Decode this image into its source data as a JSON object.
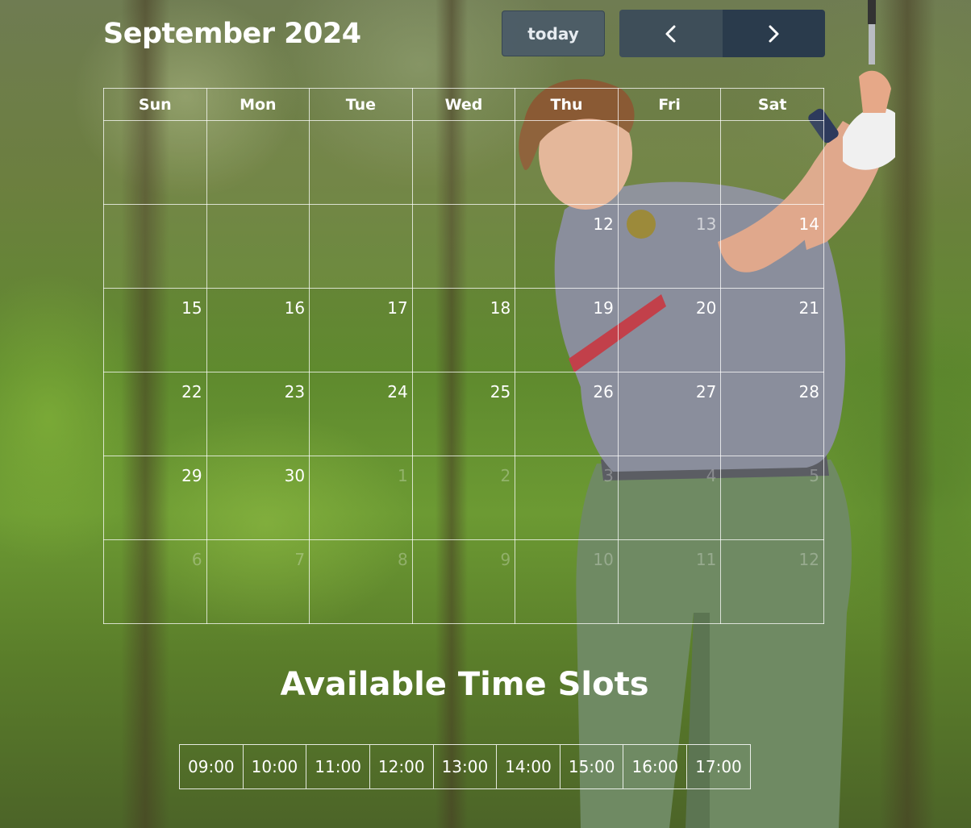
{
  "calendar": {
    "title": "September 2024",
    "today_label": "today",
    "prev_icon": "chevron-left-icon",
    "next_icon": "chevron-right-icon",
    "weekdays": [
      "Sun",
      "Mon",
      "Tue",
      "Wed",
      "Thu",
      "Fri",
      "Sat"
    ],
    "weeks": [
      [
        {
          "d": "",
          "s": "empty"
        },
        {
          "d": "",
          "s": "empty"
        },
        {
          "d": "",
          "s": "empty"
        },
        {
          "d": "",
          "s": "empty"
        },
        {
          "d": "",
          "s": "empty"
        },
        {
          "d": "",
          "s": "empty"
        },
        {
          "d": "",
          "s": "empty"
        }
      ],
      [
        {
          "d": "",
          "s": "empty"
        },
        {
          "d": "",
          "s": "empty"
        },
        {
          "d": "",
          "s": "empty"
        },
        {
          "d": "",
          "s": "empty"
        },
        {
          "d": "12",
          "s": "current"
        },
        {
          "d": "13",
          "s": "past"
        },
        {
          "d": "14",
          "s": "current"
        }
      ],
      [
        {
          "d": "15",
          "s": "current"
        },
        {
          "d": "16",
          "s": "current"
        },
        {
          "d": "17",
          "s": "current"
        },
        {
          "d": "18",
          "s": "current"
        },
        {
          "d": "19",
          "s": "current"
        },
        {
          "d": "20",
          "s": "current"
        },
        {
          "d": "21",
          "s": "current"
        }
      ],
      [
        {
          "d": "22",
          "s": "current"
        },
        {
          "d": "23",
          "s": "current"
        },
        {
          "d": "24",
          "s": "current"
        },
        {
          "d": "25",
          "s": "current"
        },
        {
          "d": "26",
          "s": "current"
        },
        {
          "d": "27",
          "s": "current"
        },
        {
          "d": "28",
          "s": "current"
        }
      ],
      [
        {
          "d": "29",
          "s": "current"
        },
        {
          "d": "30",
          "s": "current"
        },
        {
          "d": "1",
          "s": "other"
        },
        {
          "d": "2",
          "s": "other"
        },
        {
          "d": "3",
          "s": "other"
        },
        {
          "d": "4",
          "s": "other"
        },
        {
          "d": "5",
          "s": "other"
        }
      ],
      [
        {
          "d": "6",
          "s": "other"
        },
        {
          "d": "7",
          "s": "other"
        },
        {
          "d": "8",
          "s": "other"
        },
        {
          "d": "9",
          "s": "other"
        },
        {
          "d": "10",
          "s": "other"
        },
        {
          "d": "11",
          "s": "other"
        },
        {
          "d": "12",
          "s": "other"
        }
      ]
    ]
  },
  "time_slots": {
    "title": "Available Time Slots",
    "slots": [
      "09:00",
      "10:00",
      "11:00",
      "12:00",
      "13:00",
      "14:00",
      "15:00",
      "16:00",
      "17:00"
    ]
  },
  "colors": {
    "button_today": "#4a5a68",
    "button_nav": "#2c3e52",
    "grid_line": "#ffffff",
    "background_foliage": "#5f8a2e"
  }
}
